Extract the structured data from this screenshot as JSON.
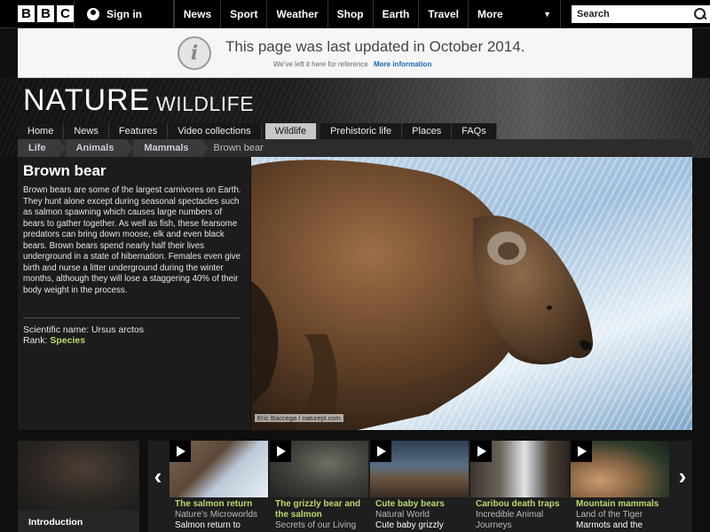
{
  "header": {
    "logo_letters": [
      "B",
      "B",
      "C"
    ],
    "signin_label": "Sign in",
    "nav": [
      "News",
      "Sport",
      "Weather",
      "Shop",
      "Earth",
      "Travel"
    ],
    "more_label": "More",
    "search_placeholder": "Search"
  },
  "notice": {
    "title": "This page was last updated in October 2014.",
    "subtitle": "We've left it here for reference",
    "more_link": "More information"
  },
  "hero": {
    "title": "NATURE",
    "subtitle": "WILDLIFE"
  },
  "section_nav": {
    "tabs": [
      "Home",
      "News",
      "Features",
      "Video collections",
      "Wildlife",
      "Prehistoric life",
      "Places",
      "FAQs"
    ],
    "active_tab": "Wildlife"
  },
  "breadcrumb": [
    "Life",
    "Animals",
    "Mammals",
    "Brown bear"
  ],
  "species": {
    "name": "Brown bear",
    "description": "Brown bears are some of the largest carnivores on Earth. They hunt alone except during seasonal spectacles such as salmon spawning which causes large numbers of bears to gather together. As well as fish, these fearsome predators can bring down moose, elk and even black bears. Brown bears spend nearly half their lives underground in a state of hibernation. Females even give birth and nurse a litter underground during the winter months, although they will lose a staggering 40% of their body weight in the process.",
    "scientific_label": "Scientific name:",
    "scientific_name": "Ursus arctos",
    "rank_label": "Rank:",
    "rank_value": "Species"
  },
  "photo": {
    "credit": "Eric Baccega / naturepl.com"
  },
  "intro": {
    "label": "Introduction"
  },
  "carousel": [
    {
      "title": "The salmon return",
      "source": "Nature's Microworlds",
      "episode": "Salmon return to"
    },
    {
      "title": "The grizzly bear and the salmon",
      "source": "Secrets of our Living",
      "episode": ""
    },
    {
      "title": "Cute baby bears",
      "source": "Natural World",
      "episode": "Cute baby grizzly"
    },
    {
      "title": "Caribou death traps",
      "source": "Incredible Animal Journeys",
      "episode": ""
    },
    {
      "title": "Mountain mammals",
      "source": "Land of the Tiger",
      "episode": "Marmots and the"
    }
  ],
  "colors": {
    "link_green": "#b9d96e",
    "link_blue": "#1a66b8"
  }
}
